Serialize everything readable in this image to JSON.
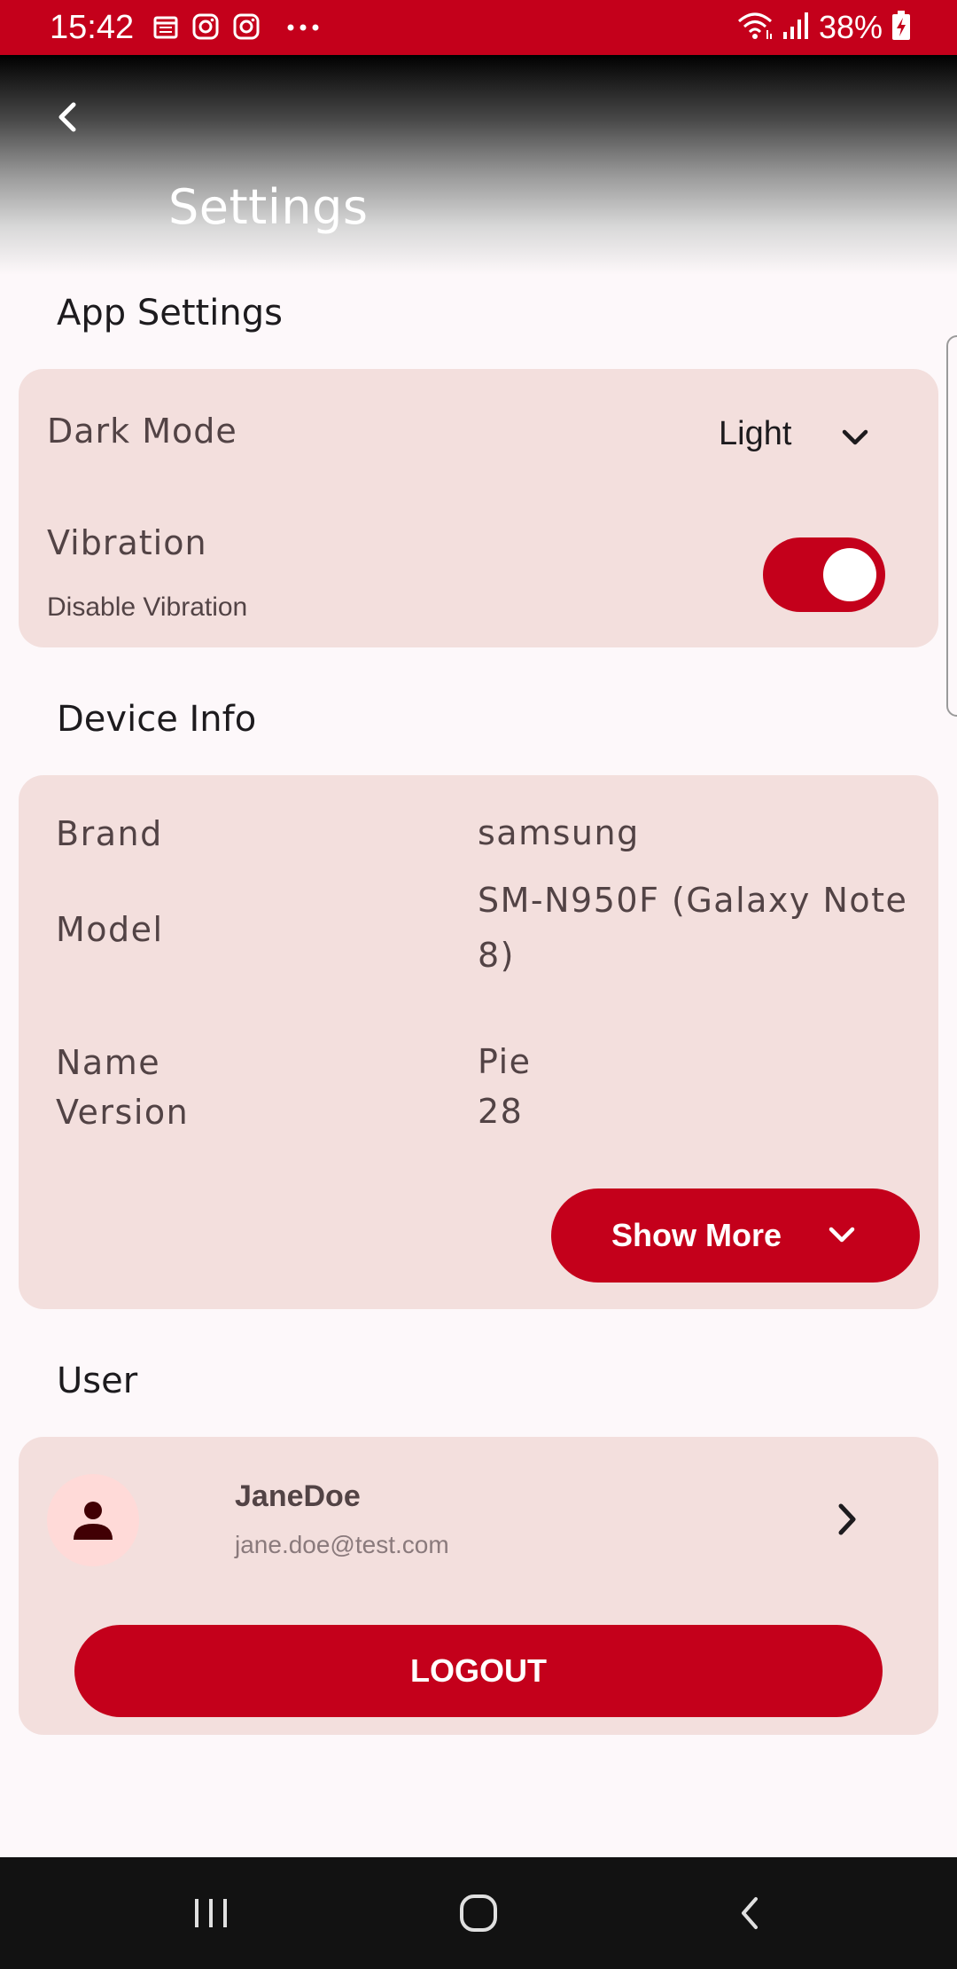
{
  "status_bar": {
    "time": "15:42",
    "battery": "38%",
    "icons_left": [
      "calendar-icon",
      "instagram-icon",
      "instagram-icon",
      "more-dots-icon"
    ],
    "icons_right": [
      "wifi-icon",
      "signal-icon",
      "battery-charging-icon"
    ]
  },
  "header": {
    "title": "Settings",
    "back_icon": "chevron-left-icon"
  },
  "app_settings": {
    "section_title": "App Settings",
    "dark_mode": {
      "label": "Dark Mode",
      "value": "Light"
    },
    "vibration": {
      "label": "Vibration",
      "sublabel": "Disable Vibration",
      "enabled": true
    }
  },
  "device_info": {
    "section_title": "Device Info",
    "rows": [
      {
        "label": "Brand",
        "value": "samsung"
      },
      {
        "label": "Model",
        "value": "SM-N950F (Galaxy Note 8)"
      },
      {
        "label": "Name",
        "value": "Pie"
      },
      {
        "label": "Version",
        "value": "28"
      }
    ],
    "show_more_label": "Show More"
  },
  "user": {
    "section_title": "User",
    "name": "JaneDoe",
    "email": "jane.doe@test.com",
    "logout_label": "LOGOUT"
  },
  "colors": {
    "primary": "#c4001b",
    "card": "#f3dfdd",
    "background": "#fdf8fa",
    "text": "#524345"
  }
}
